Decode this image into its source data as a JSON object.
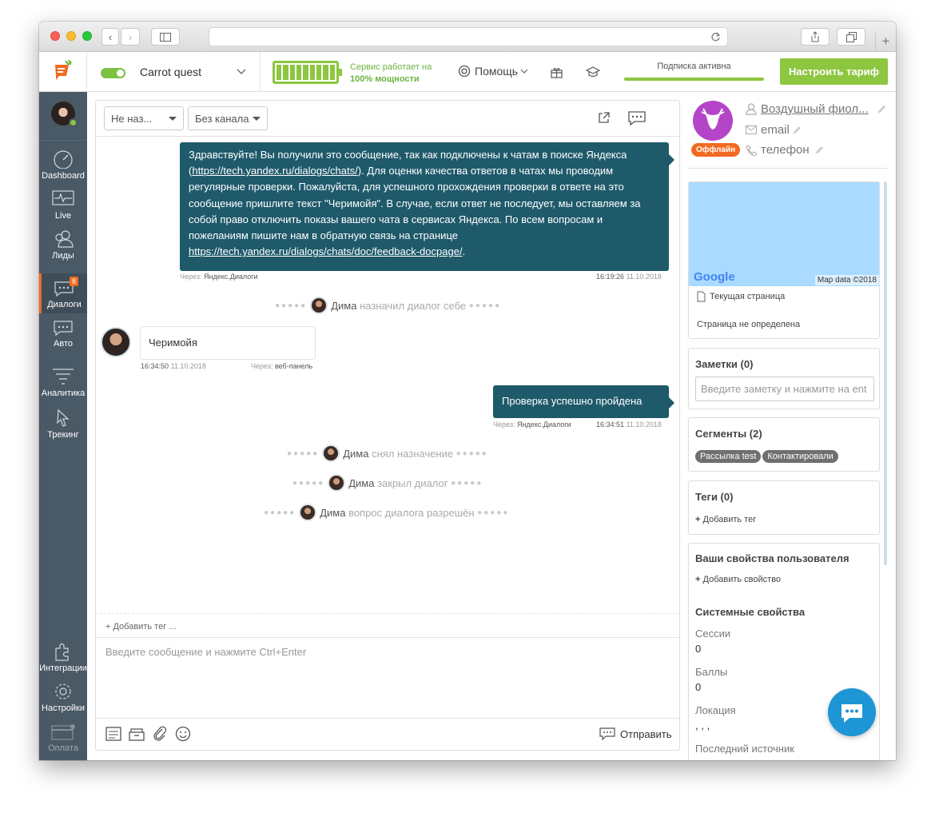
{
  "browser": {
    "tab_plus": "+"
  },
  "app": {
    "company": "Carrot quest",
    "battery_text_1": "Сервис работает на",
    "battery_text_2": "100% мощности",
    "help_label": "Помощь",
    "subscription_label": "Подписка активна",
    "tariff_button": "Настроить тариф",
    "accent": "#8dc63f"
  },
  "nav": {
    "items": [
      {
        "label": "Dashboard"
      },
      {
        "label": "Live"
      },
      {
        "label": "Лиды"
      },
      {
        "label": "Диалоги",
        "badge": "8"
      },
      {
        "label": "Авто"
      },
      {
        "label": "Аналитика"
      },
      {
        "label": "Трекинг"
      },
      {
        "label": "Интеграции"
      },
      {
        "label": "Настройки"
      },
      {
        "label": "Оплата"
      }
    ]
  },
  "chat": {
    "filter1": "Не наз...",
    "filter2": "Без канала",
    "messages": {
      "m1_parts": [
        "Здравствуйте! Вы получили это сообщение, так как подключены к чатам в поиске Яндекса (",
        "https://tech.yandex.ru/dialogs/chats/",
        "). Для оценки качества ответов в чатах мы проводим регулярные проверки. Пожалуйста, для успешного прохождения проверки в ответе на это сообщение пришлите текст \"Черимойя\". В случае, если ответ не последует, мы оставляем за собой право отключить показы вашего чата в сервисах Яндекса. По всем вопросам и пожеланиям пишите нам в обратную связь на странице ",
        "https://tech.yandex.ru/dialogs/chats/doc/feedback-docpage/",
        "."
      ],
      "m1_via_label": "Через:",
      "m1_via": "Яндекс.Диалоги",
      "m1_time": "16:19:26",
      "m1_date": "11.10.2018",
      "sys1_name": "Дима",
      "sys1_text": "назначил диалог себе",
      "m2_text": "Черимойя",
      "m2_time": "16:34:50",
      "m2_date": "11.10.2018",
      "m2_via_label": "Через:",
      "m2_via": "веб-панель",
      "m3_text": "Проверка успешно пройдена",
      "m3_via_label": "Через:",
      "m3_via": "Яндекс.Диалоги",
      "m3_time": "16:34:51",
      "m3_date": "11.10.2018",
      "sys2_name": "Дима",
      "sys2_text": "снял назначение",
      "sys3_name": "Дима",
      "sys3_text": "закрыл диалог",
      "sys4_name": "Дима",
      "sys4_text": "вопрос диалога разрешён"
    },
    "add_tag": "+ Добавить тег ...",
    "input_placeholder": "Введите сообщение и нажмите Ctrl+Enter",
    "send_label": "Отправить",
    "bubble_color": "#1f5a6b"
  },
  "user": {
    "name": "Воздушный фиол...",
    "email": "email",
    "phone": "телефон",
    "status": "Оффлайн",
    "map_brand": "Google",
    "map_credit": "Map data ©2018",
    "current_page_label": "Текущая страница",
    "page_value": "Страница не определена"
  },
  "notes": {
    "title": "Заметки (0)",
    "placeholder": "Введите заметку и нажмите на ent"
  },
  "segments": {
    "title": "Сегменты (2)",
    "items": [
      "Рассылка test",
      "Контактировали"
    ]
  },
  "tags": {
    "title": "Теги (0)",
    "add": "Добавить тег"
  },
  "props": {
    "title": "Ваши свойства пользователя",
    "add": "Добавить свойство",
    "system_title": "Системные свойства",
    "sessions_label": "Сессии",
    "sessions_value": "0",
    "score_label": "Баллы",
    "score_value": "0",
    "location_label": "Локация",
    "location_value": ", , ,",
    "last_source_label": "Последний источник"
  }
}
